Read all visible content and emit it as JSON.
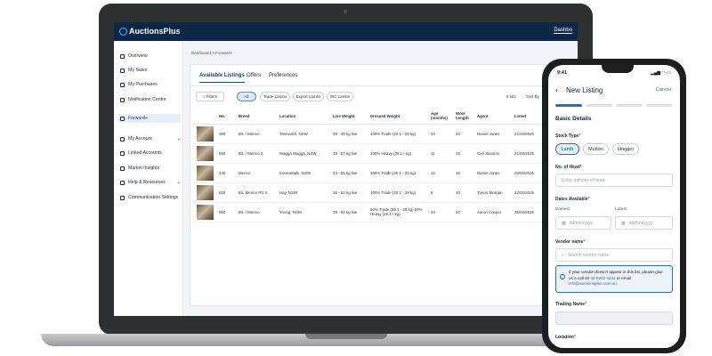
{
  "app": {
    "brand": "AuctionsPlus",
    "top_right": "Dashbo"
  },
  "sidebar": {
    "items": [
      {
        "label": "Overview",
        "icon": "grid-icon"
      },
      {
        "label": "My Sales",
        "icon": "tag-icon"
      },
      {
        "label": "My Purchases",
        "icon": "cart-icon"
      },
      {
        "label": "Notification Centre",
        "icon": "bell-icon"
      },
      {
        "label": "Forward+",
        "icon": "dollar-icon"
      },
      {
        "label": "My Account",
        "icon": "user-icon"
      },
      {
        "label": "Linked Accounts",
        "icon": "link-icon"
      },
      {
        "label": "Market Insights",
        "icon": "chart-icon"
      },
      {
        "label": "Help & Resources",
        "icon": "help-icon"
      },
      {
        "label": "Communication Settings",
        "icon": "gear-icon"
      }
    ],
    "collapse": "«"
  },
  "breadcrumb": "Dashboard  >  Forward+",
  "tabs": [
    "Available Listings",
    "Offers",
    "Preferences"
  ],
  "filters": {
    "button": "Filters",
    "chips": [
      "All",
      "Trade Lambs",
      "Export Lambs",
      "WC Lambs"
    ],
    "count": "5 lots",
    "sort": "Sort By"
  },
  "table": {
    "headers": [
      "",
      "No.",
      "Breed",
      "Location",
      "Live Weight",
      "Dressed Weight",
      "Age (months)",
      "Wool Length",
      "Agent",
      "Listed"
    ],
    "rows": [
      [
        "",
        "400",
        "B/L / Merino",
        "Tamworth, NSW",
        "38 - 49 kg live",
        "100% Trade (20.1 - 28 kg)",
        "10",
        "20",
        "Daniel Jones",
        "21/03/2025"
      ],
      [
        "",
        "660",
        "B/L / Merino X",
        "Wagga Wagga, NSW",
        "49 - 57 kg live",
        "100% Heavy (28.1+ kg)",
        "11",
        "25",
        "Carl Stevens",
        "21/03/2025"
      ],
      [
        "",
        "440",
        "Merino",
        "Coonamble, NSW",
        "34 - 55 kg live",
        "100% Trade (20.1 - 28 kg)",
        "12",
        "15",
        "Daniel Jones",
        "20/03/2025"
      ],
      [
        "",
        "820",
        "B/L Merino PD X",
        "Hay, NSW",
        "36 - 52 kg live",
        "100% Trade (20.1 - 28 kg)",
        "8",
        "20",
        "Trevor Morgan",
        "22/03/2025"
      ],
      [
        "",
        "560",
        "B/L / Merino",
        "Young, NSW",
        "38 - 62 kg live",
        "50% Trade (20.1 - 28 kg) 50% Heavy (28.1+ kg)",
        "10",
        "20",
        "Aaron Cooper",
        "25/03/2025"
      ]
    ]
  },
  "phone": {
    "time": "9:41",
    "status": "▂▄▆ ◠ ▭",
    "title": "New Listing",
    "back": "‹",
    "cancel": "Cancel",
    "section": "Basic Details",
    "stock_type_label": "Stock Type",
    "stock_types": [
      "Lamb",
      "Mutton",
      "Hogget"
    ],
    "head_label": "No. of Head",
    "head_placeholder": "Enter number of head",
    "dates_label": "Dates Available",
    "earliest": "Earliest",
    "latest": "Latest",
    "date_placeholder": "dd/mm/yyyy",
    "vendor_label": "Vendor name",
    "vendor_placeholder": "Search vendor name",
    "info_text": "If your vendor doesn't appear in this list, please give us a call on",
    "info_phone": "02 9262 4222",
    "info_mid": "or email",
    "info_email": "info@auctionsplus.com.au",
    "trading_label": "Trading Name",
    "location_label": "Location",
    "req": "*"
  }
}
